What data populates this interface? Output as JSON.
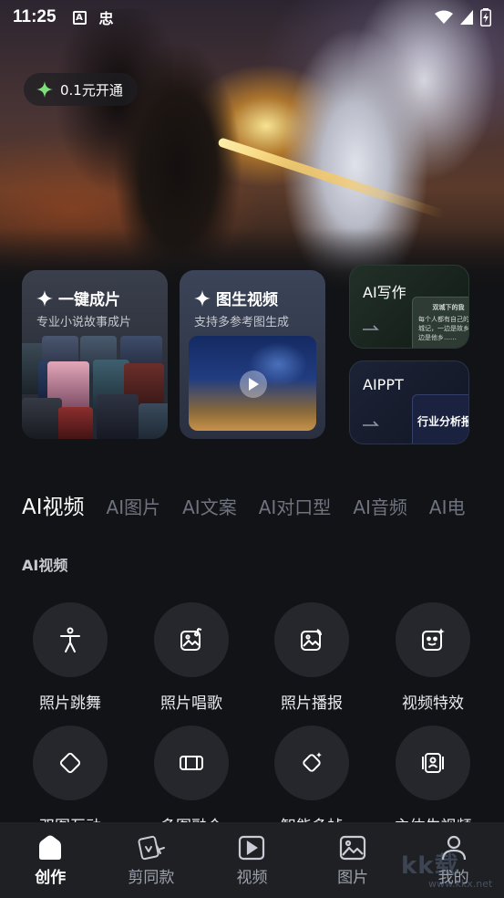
{
  "status_bar": {
    "time": "11:25",
    "app_glyph": "忠",
    "a_glyph": "A"
  },
  "hero": {
    "vip_label": "0.1元开通"
  },
  "cards": {
    "one_click": {
      "title": "一键成片",
      "subtitle": "专业小说故事成片"
    },
    "image_to_video": {
      "title": "图生视频",
      "subtitle": "支持多参考图生成"
    },
    "ai_writing": {
      "title": "AI写作",
      "preview_heading": "双城下的我",
      "preview_text": "每个人都有自己的双城记，一边是故乡一边是他乡……"
    },
    "ai_ppt": {
      "title": "AIPPT",
      "preview_title": "行业分析报告"
    }
  },
  "tabs": [
    "AI视频",
    "AI图片",
    "AI文案",
    "AI对口型",
    "AI音频",
    "AI电"
  ],
  "section_title": "AI视频",
  "tools": [
    {
      "label": "照片跳舞",
      "icon": "dance-icon"
    },
    {
      "label": "照片唱歌",
      "icon": "photo-sing-icon"
    },
    {
      "label": "照片播报",
      "icon": "photo-broadcast-icon"
    },
    {
      "label": "视频特效",
      "icon": "video-effect-icon"
    },
    {
      "label": "双图互动",
      "icon": "dual-image-icon"
    },
    {
      "label": "多图融合",
      "icon": "multi-image-icon"
    },
    {
      "label": "智能多帧",
      "icon": "smart-frames-icon"
    },
    {
      "label": "主体生视频",
      "icon": "subject-video-icon"
    }
  ],
  "bottom_nav": [
    {
      "label": "创作",
      "icon": "home-icon",
      "active": true
    },
    {
      "label": "剪同款",
      "icon": "template-icon",
      "active": false
    },
    {
      "label": "视频",
      "icon": "video-icon",
      "active": false
    },
    {
      "label": "图片",
      "icon": "image-icon",
      "active": false
    },
    {
      "label": "我的",
      "icon": "profile-icon",
      "active": false
    }
  ],
  "watermark": {
    "main": "kk载",
    "sub": "www.kkx.net"
  }
}
